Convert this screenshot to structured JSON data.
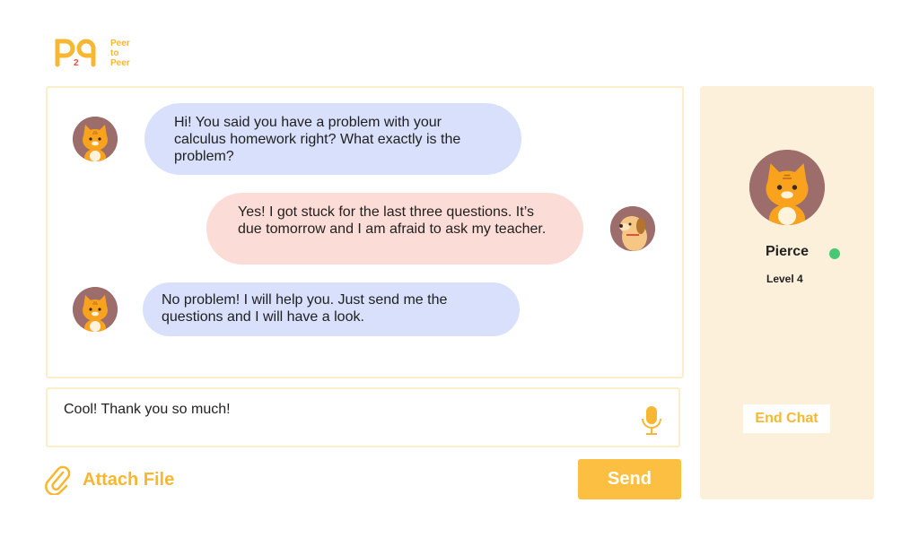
{
  "brand": {
    "logo_mark": "P2P",
    "logo_lines": [
      "Peer",
      "to",
      "Peer"
    ],
    "accent": "#f7b733"
  },
  "messages": [
    {
      "sender": "other",
      "avatar": "cat-icon",
      "text": "Hi! You said you have a problem with your calculus homework right? What exactly is the problem?"
    },
    {
      "sender": "self",
      "avatar": "dog-icon",
      "text": "Yes! I got stuck for the last three questions. It’s due tomorrow and I am afraid to ask my teacher."
    },
    {
      "sender": "other",
      "avatar": "cat-icon",
      "text": "No problem! I will help you. Just send me the questions and I will have a look."
    }
  ],
  "composer": {
    "value": "Cool! Thank you so much!",
    "mic_icon": "microphone-icon"
  },
  "actions": {
    "attach_label": "Attach File",
    "attach_icon": "paperclip-icon",
    "send_label": "Send"
  },
  "profile": {
    "name": "Pierce",
    "level": "Level 4",
    "status_color": "#48c774",
    "end_chat_label": "End Chat"
  }
}
